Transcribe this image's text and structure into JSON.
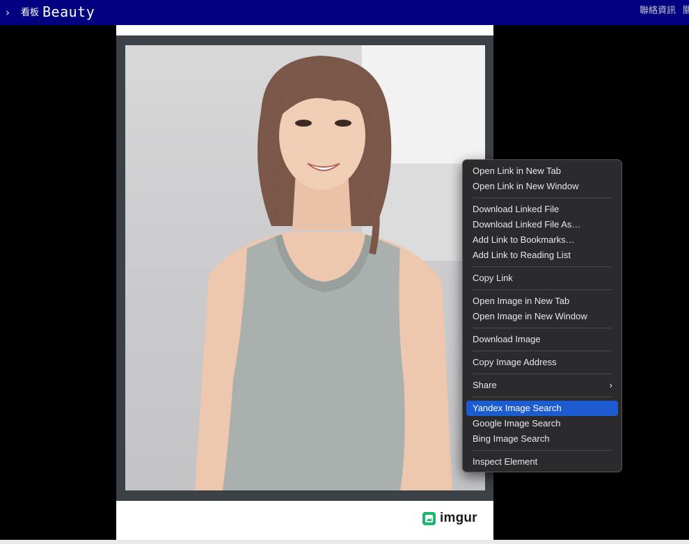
{
  "header": {
    "chevron_icon": "chevron-right-icon",
    "board_word": "看板",
    "board_name": "Beauty",
    "right_links": [
      "聯絡資訊",
      "關"
    ]
  },
  "content": {
    "photo_icon": "photo-of-woman",
    "imgur_label": "imgur",
    "imgur_icon": "imgur-logo-icon",
    "imgur_color": "#1bb76e"
  },
  "context_menu": {
    "groups": [
      [
        "Open Link in New Tab",
        "Open Link in New Window"
      ],
      [
        "Download Linked File",
        "Download Linked File As…",
        "Add Link to Bookmarks…",
        "Add Link to Reading List"
      ],
      [
        "Copy Link"
      ],
      [
        "Open Image in New Tab",
        "Open Image in New Window"
      ],
      [
        "Download Image"
      ],
      [
        "Copy Image Address"
      ],
      [
        "Share"
      ],
      [
        "Yandex Image Search",
        "Google Image Search",
        "Bing Image Search"
      ],
      [
        "Inspect Element"
      ]
    ],
    "highlighted_item": "Yandex Image Search",
    "submenu_item": "Share",
    "highlight_color": "#1d5bd1"
  },
  "colors": {
    "topbar": "#000080",
    "page_background": "#000000",
    "frame": "#3c4148",
    "menu_background": "#2b2b2d"
  }
}
